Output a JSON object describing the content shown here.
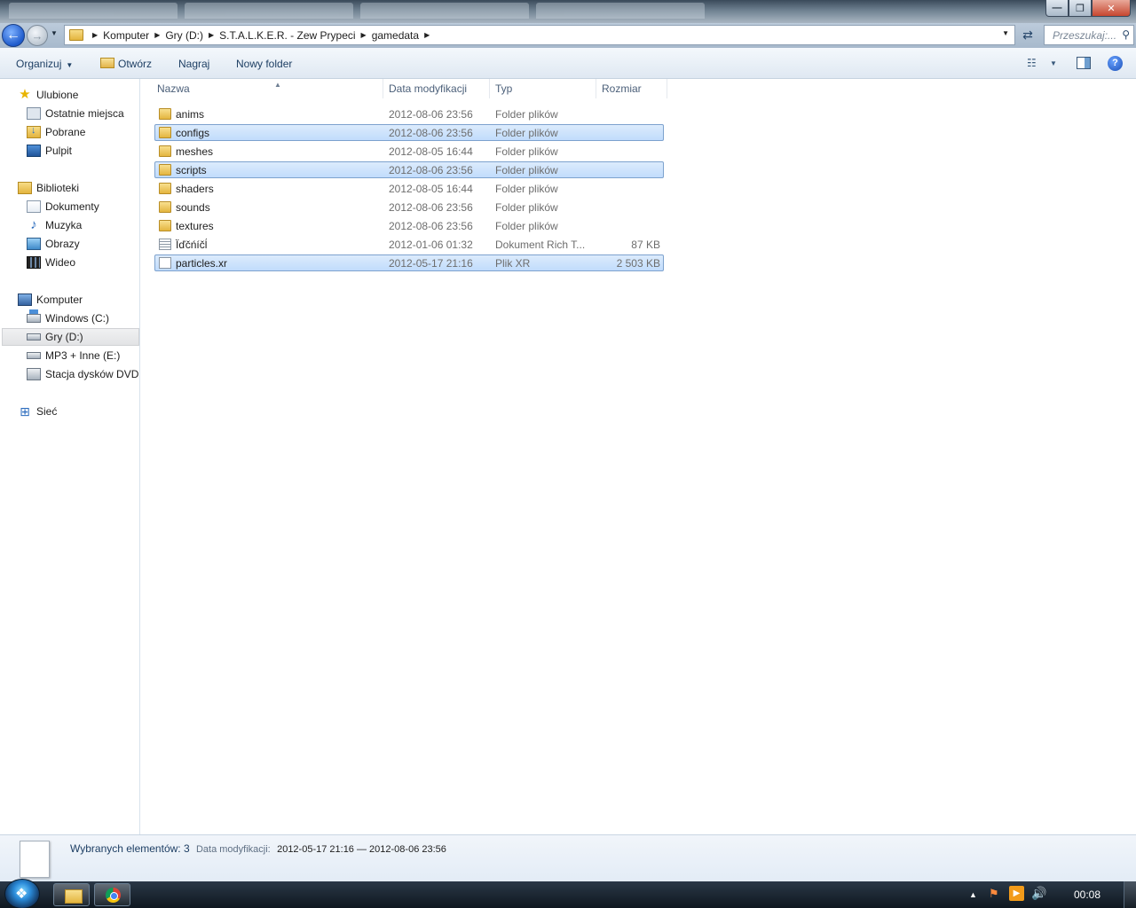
{
  "window": {
    "title_controls": {
      "minimize": "—",
      "maximize": "❐",
      "close": "✕"
    }
  },
  "navigation": {
    "back_glyph": "←",
    "forward_glyph": "→",
    "breadcrumb": [
      "Komputer",
      "Gry (D:)",
      "S.T.A.L.K.E.R. - Zew Prypeci",
      "gamedata"
    ],
    "search_placeholder": "Przeszukaj:..."
  },
  "commands": {
    "organize": "Organizuj",
    "open": "Otwórz",
    "burn": "Nagraj",
    "new_folder": "Nowy folder"
  },
  "sidebar": {
    "favorites": {
      "label": "Ulubione",
      "items": [
        "Ostatnie miejsca",
        "Pobrane",
        "Pulpit"
      ]
    },
    "libraries": {
      "label": "Biblioteki",
      "items": [
        "Dokumenty",
        "Muzyka",
        "Obrazy",
        "Wideo"
      ]
    },
    "computer": {
      "label": "Komputer",
      "items": [
        "Windows (C:)",
        "Gry (D:)",
        "MP3 + Inne (E:)",
        "Stacja dysków DVD RW"
      ],
      "selected": "Gry (D:)"
    },
    "network": {
      "label": "Sieć"
    }
  },
  "file_list": {
    "columns": [
      "Nazwa",
      "Data modyfikacji",
      "Typ",
      "Rozmiar"
    ],
    "rows": [
      {
        "name": "anims",
        "date": "2012-08-06 23:56",
        "type": "Folder plików",
        "size": "",
        "icon": "folder-icon",
        "selected": false
      },
      {
        "name": "configs",
        "date": "2012-08-06 23:56",
        "type": "Folder plików",
        "size": "",
        "icon": "folder-icon",
        "selected": true
      },
      {
        "name": "meshes",
        "date": "2012-08-05 16:44",
        "type": "Folder plików",
        "size": "",
        "icon": "folder-icon",
        "selected": false
      },
      {
        "name": "scripts",
        "date": "2012-08-06 23:56",
        "type": "Folder plików",
        "size": "",
        "icon": "folder-icon",
        "selected": true
      },
      {
        "name": "shaders",
        "date": "2012-08-05 16:44",
        "type": "Folder plików",
        "size": "",
        "icon": "folder-icon",
        "selected": false
      },
      {
        "name": "sounds",
        "date": "2012-08-06 23:56",
        "type": "Folder plików",
        "size": "",
        "icon": "folder-icon",
        "selected": false
      },
      {
        "name": "textures",
        "date": "2012-08-06 23:56",
        "type": "Folder plików",
        "size": "",
        "icon": "folder-icon",
        "selected": false
      },
      {
        "name": "Ïďčńíčĺ",
        "date": "2012-01-06 01:32",
        "type": "Dokument Rich T...",
        "size": "87 KB",
        "icon": "rtf-document-icon",
        "selected": false
      },
      {
        "name": "particles.xr",
        "date": "2012-05-17 21:16",
        "type": "Plik XR",
        "size": "2 503 KB",
        "icon": "file-icon",
        "selected": true
      }
    ]
  },
  "details": {
    "selected_count": "Wybranych elementów: 3",
    "modified_label": "Data modyfikacji:",
    "modified_value": "2012-05-17 21:16 — 2012-08-06 23:56"
  },
  "taskbar": {
    "clock": "00:08"
  }
}
